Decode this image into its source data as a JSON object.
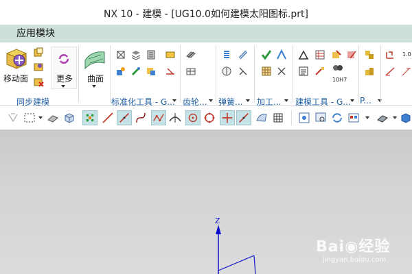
{
  "window": {
    "title": "NX 10 - 建模 - [UG10.0如何建模太阳图标.prt]"
  },
  "menubar": {
    "app_modules": "应用模块"
  },
  "ribbon": {
    "move_face_label": "移动面",
    "more_label": "更多",
    "surface_label": "曲面",
    "tolerance_label": "10H7",
    "decimal_label": "1.0",
    "groups": {
      "sync_modeling": "同步建模",
      "standard_tools": "标准化工具 - G...",
      "gear": "齿轮...",
      "spring": "弹簧...",
      "machining": "加工...",
      "modeling_tools": "建模工具 - G...",
      "p_group": "P..."
    },
    "colors": {
      "group_label": "#1f5fa5",
      "menubar_bg": "#cfe0dc"
    }
  },
  "viewport": {
    "z_axis_label": "Z",
    "axis_color": "#1010cc"
  },
  "watermark": {
    "brand": "Bai",
    "suffix": "经验",
    "url": "jingyan.baidu.com"
  }
}
